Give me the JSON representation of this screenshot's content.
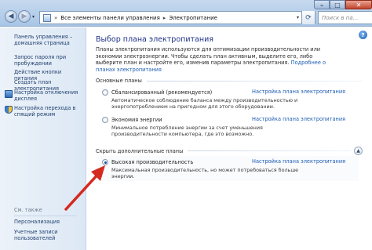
{
  "window": {
    "address": {
      "crumb_root": "Все элементы панели управления",
      "crumb_current": "Электропитание",
      "separator": "»",
      "crumb_arrow": "▸"
    },
    "search_placeholder": "Поиск в па...",
    "buttons": {
      "minimize": "–",
      "maximize": "□",
      "close": "✕"
    }
  },
  "sidebar": {
    "items": [
      {
        "label": "Панель управления – домашняя страница"
      },
      {
        "label": "Запрос пароля при пробуждении"
      },
      {
        "label": "Действие кнопки питания"
      },
      {
        "label": "Создать план электропитания"
      },
      {
        "label": "Настройка отключения дисплея",
        "icon": "monitor-icon"
      },
      {
        "label": "Настройка перехода в спящий режим",
        "icon": "shield-icon"
      }
    ],
    "see_also": "См. также",
    "see_also_items": [
      {
        "label": "Персонализация"
      },
      {
        "label": "Учетные записи пользователей"
      }
    ]
  },
  "main": {
    "title": "Выбор плана электропитания",
    "description": "Планы электропитания используются для оптимизации производительности или экономии электроэнергии. Чтобы сделать план активным, выделите его, либо выберите план и настройте его, изменив параметры электропитания.",
    "description_link": "Подробнее о планах электропитания",
    "groups": {
      "main_plans": "Основные планы",
      "hidden_plans": "Скрыть дополнительные планы"
    },
    "plans": [
      {
        "name": "Сбалансированный (рекомендуется)",
        "desc": "Автоматическое соблюдение баланса между производительностью и энергопотреблением на пригодном для этого оборудовании.",
        "link": "Настройка плана электропитания",
        "checked": false
      },
      {
        "name": "Экономия энергии",
        "desc": "Минимальное потребление энергии за счет уменьшения производительности компьютера, где это возможно.",
        "link": "Настройка плана электропитания",
        "checked": false
      },
      {
        "name": "Высокая производительность",
        "desc": "Максимальная производительность, но может потребоваться больше энергии.",
        "link": "Настройка плана электропитания",
        "checked": true
      }
    ],
    "colors": {
      "title": "#1e3287",
      "link": "#1e5eb3",
      "arrow": "#d42a1f"
    }
  }
}
